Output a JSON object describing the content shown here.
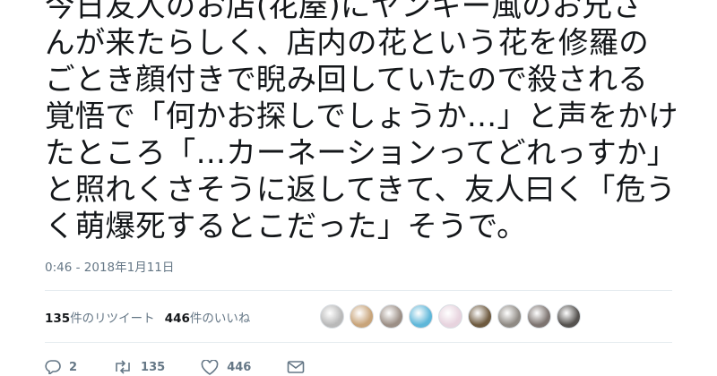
{
  "tweet": {
    "lines": [
      "今日友人のお店(花屋)にヤンキー風のお兄さ",
      "んが来たらしく、店内の花という花を修羅の",
      "ごとき顔付きで睨み回していたので殺される",
      "覚悟で「何かお探しでしょうか…」と声をかけ",
      "たところ「…カーネーションってどれっすか」",
      "と照れくさそうに返してきて、友人曰く「危う",
      "く萌爆死するとこだった」そうで。"
    ],
    "timestamp": "0:46 - 2018年1月11日"
  },
  "stats": {
    "retweets_count": "135",
    "retweets_label": "件のリツイート",
    "likes_count": "446",
    "likes_label": "件のいいね"
  },
  "avatars": [
    {
      "name": "avatar-1",
      "color": "#b9b9b9"
    },
    {
      "name": "avatar-2",
      "color": "#c8a47a"
    },
    {
      "name": "avatar-3",
      "color": "#9c8f86"
    },
    {
      "name": "avatar-4",
      "color": "#5fb7d9"
    },
    {
      "name": "avatar-5",
      "color": "#e7d3de"
    },
    {
      "name": "avatar-6",
      "color": "#6e5a3f"
    },
    {
      "name": "avatar-7",
      "color": "#8f8a84"
    },
    {
      "name": "avatar-8",
      "color": "#7d7470"
    },
    {
      "name": "avatar-9",
      "color": "#55524f"
    }
  ],
  "actions": {
    "reply_count": "2",
    "retweet_count": "135",
    "like_count": "446"
  },
  "colors": {
    "text": "#14171a",
    "muted": "#657786",
    "divider": "#e6ecf0"
  }
}
